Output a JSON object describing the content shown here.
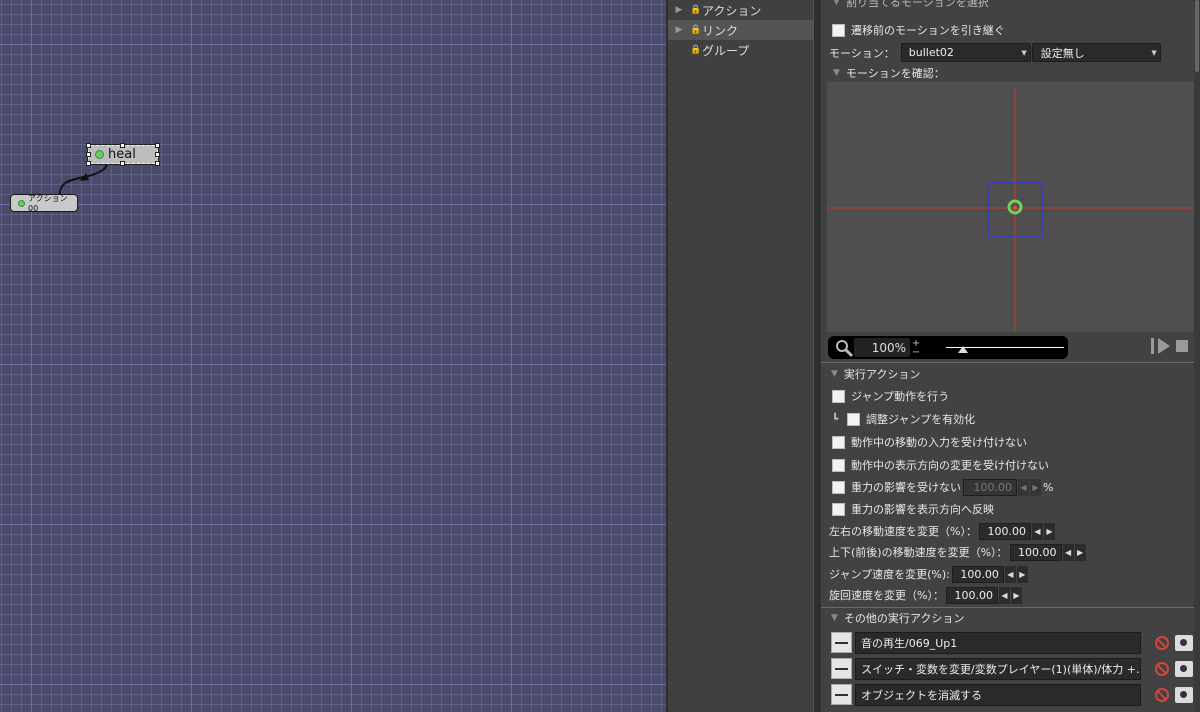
{
  "graph": {
    "nodes": [
      {
        "label": "heal"
      },
      {
        "label": "アクション00"
      }
    ]
  },
  "tree": {
    "items": [
      {
        "label": "アクション"
      },
      {
        "label": "リンク"
      },
      {
        "label": "グループ"
      }
    ]
  },
  "props": {
    "section_top_label": "割り当てるモーションを選択",
    "inherit_motion_label": "遷移前のモーションを引き継ぐ",
    "motion_label": "モーション：",
    "motion_value": "bullet02",
    "motion_setting_value": "設定無し",
    "confirm_motion_label": "モーションを確認：",
    "zoom": {
      "value": "100%",
      "plus": "+",
      "minus": "−"
    },
    "exec_section_label": "実行アクション",
    "checks": {
      "jump": "ジャンプ動作を行う",
      "adjust_jump_prefix": "┗",
      "adjust_jump": "調整ジャンプを有効化",
      "no_move_input": "動作中の移動の入力を受け付けない",
      "no_direction_change": "動作中の表示方向の変更を受け付けない",
      "no_gravity": "重力の影響を受けない",
      "gravity_value": "100.00",
      "gravity_unit": "%",
      "gravity_direction": "重力の影響を表示方向へ反映"
    },
    "speeds": [
      {
        "label": "左右の移動速度を変更（%）：",
        "value": "100.00"
      },
      {
        "label": "上下(前後)の移動速度を変更（%）：",
        "value": "100.00"
      },
      {
        "label": "ジャンプ速度を変更(%):",
        "value": "100.00"
      },
      {
        "label": "旋回速度を変更（%）：",
        "value": "100.00"
      }
    ],
    "other_section_label": "その他の実行アクション",
    "other_actions": [
      {
        "text": "音の再生/069_Up1"
      },
      {
        "text": "スイッチ・変数を変更/変数プレイヤー(1)(単体)/体力 +…"
      },
      {
        "text": "オブジェクトを消滅する"
      }
    ]
  },
  "colors": {
    "graph_bg": "#4a4b6a",
    "crosshair": "#c0392b",
    "bbox": "#3a3ad0",
    "marker": "#6fd35a",
    "ban": "#d2453e"
  }
}
